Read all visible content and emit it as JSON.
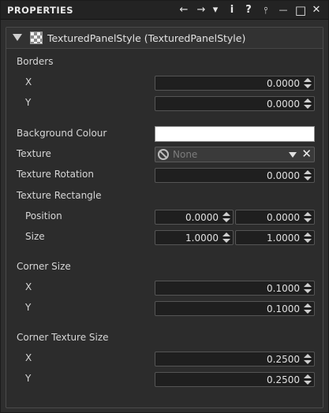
{
  "window": {
    "title": "PROPERTIES",
    "toolbar_icons": [
      "back-arrow-icon",
      "forward-arrow-icon",
      "menu-dropdown-icon",
      "info-icon",
      "help-icon",
      "pin-icon",
      "minimize-icon",
      "maximize-icon",
      "close-icon"
    ],
    "toolbar_glyphs": {
      "back": "←",
      "forward": "→",
      "menu": "▾",
      "info": "i",
      "help": "?",
      "pin": "⫯",
      "minimize": "—",
      "maximize": "□",
      "close": "✕"
    }
  },
  "panel": {
    "header_title": "TexturedPanelStyle (TexturedPanelStyle)"
  },
  "borders": {
    "label": "Borders",
    "x_label": "X",
    "x_value": "0.0000",
    "y_label": "Y",
    "y_value": "0.0000"
  },
  "background_colour": {
    "label": "Background Colour",
    "value": "#ffffff"
  },
  "texture": {
    "label": "Texture",
    "value": "None"
  },
  "texture_rotation": {
    "label": "Texture Rotation",
    "value": "0.0000"
  },
  "texture_rectangle": {
    "label": "Texture Rectangle",
    "position_label": "Position",
    "position_x": "0.0000",
    "position_y": "0.0000",
    "size_label": "Size",
    "size_x": "1.0000",
    "size_y": "1.0000"
  },
  "corner_size": {
    "label": "Corner Size",
    "x_label": "X",
    "x_value": "0.1000",
    "y_label": "Y",
    "y_value": "0.1000"
  },
  "corner_texture_size": {
    "label": "Corner Texture Size",
    "x_label": "X",
    "x_value": "0.2500",
    "y_label": "Y",
    "y_value": "0.2500"
  }
}
